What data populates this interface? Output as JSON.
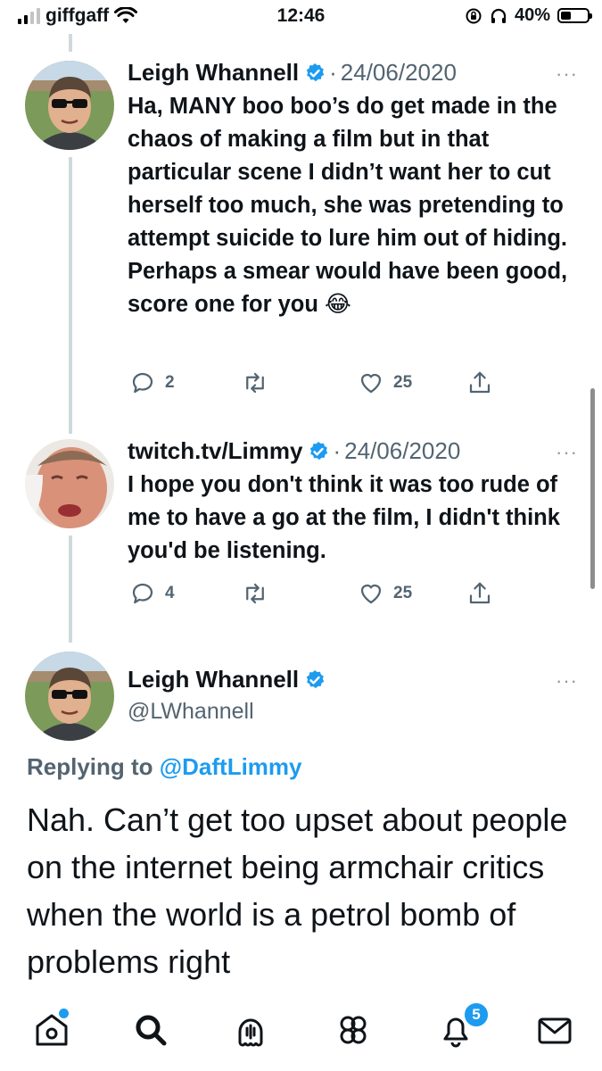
{
  "status_bar": {
    "carrier": "giffgaff",
    "time": "12:46",
    "battery_percent": "40%",
    "battery_level": 0.4,
    "icons": [
      "signal-bars-icon",
      "wifi-icon",
      "orientation-lock-icon",
      "headphones-icon",
      "battery-icon"
    ]
  },
  "thread": [
    {
      "name": "Leigh Whannell",
      "verified": true,
      "date": "24/06/2020",
      "text": "Ha, MANY boo boo’s do get made in the chaos of making a film but in that particular scene I didn’t want her to cut herself too much, she was pretending to attempt suicide to lure him out of hiding. Perhaps a smear would have been good, score one for you 😂",
      "replies": "2",
      "likes": "25"
    },
    {
      "name": "twitch.tv/Limmy",
      "verified": true,
      "date": "24/06/2020",
      "text": "I hope you don't think it was too rude of me to have a go at the film, I didn't think you'd be listening.",
      "replies": "4",
      "likes": "25"
    }
  ],
  "main_tweet": {
    "name": "Leigh Whannell",
    "verified": true,
    "handle": "@LWhannell",
    "replying_prefix": "Replying to",
    "replying_to": "@DaftLimmy",
    "text": "Nah. Can’t get too upset about people on the internet being armchair critics when the world is a petrol bomb of problems right"
  },
  "more_glyph": "···",
  "dot_separator": "·",
  "tab_bar": {
    "tabs": [
      "home-icon",
      "search-icon",
      "spaces-icon",
      "communities-icon",
      "notifications-icon",
      "messages-icon"
    ],
    "notification_count": "5"
  },
  "colors": {
    "accent": "#1d9bf0",
    "secondary_text": "#536471",
    "thread_line": "#cfd9de"
  }
}
